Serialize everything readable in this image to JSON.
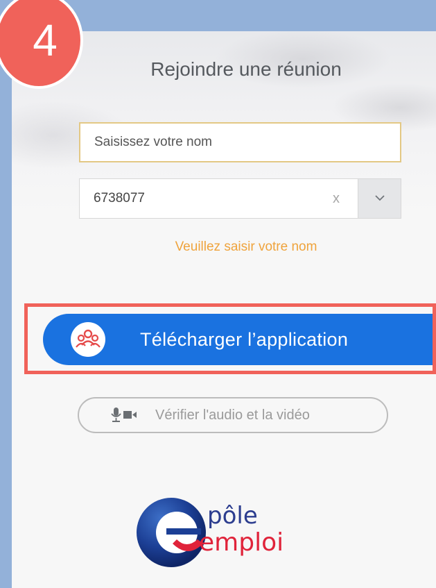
{
  "step": {
    "number": "4"
  },
  "join": {
    "title": "Rejoindre une réunion",
    "name_placeholder": "Saisissez votre nom",
    "meeting_id": "6738077",
    "clear_symbol": "x",
    "dropdown_symbol": "⌄",
    "error_message": "Veuillez saisir votre nom"
  },
  "actions": {
    "download_label": "Télécharger l’application",
    "check_av_label": "Vérifier l'audio et la vidéo"
  },
  "logo": {
    "line1": "pôle",
    "line2": "emploi"
  },
  "colors": {
    "background": "#93b1d9",
    "badge": "#f0625a",
    "primary_button": "#1a72e0",
    "error_text": "#efa33c",
    "logo_blue": "#2c3d8f",
    "logo_red": "#e0233a"
  }
}
